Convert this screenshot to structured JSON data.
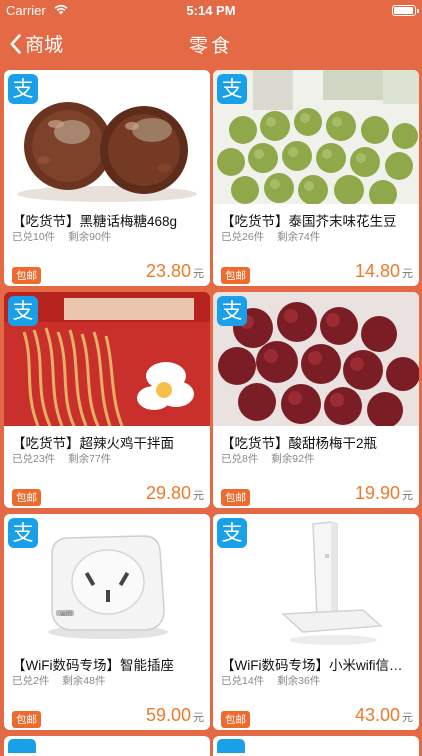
{
  "status_bar": {
    "carrier": "Carrier",
    "time": "5:14 PM"
  },
  "nav": {
    "back_label": "商城",
    "title": "零食"
  },
  "badge_char": "支",
  "products": [
    {
      "title": "【吃货节】黑糖话梅糖468g",
      "exchanged": "已兑10件",
      "remaining": "剩余90件",
      "tag": "包邮",
      "price": "23.80",
      "unit": "元"
    },
    {
      "title": "【吃货节】泰国芥末味花生豆",
      "exchanged": "已兑26件",
      "remaining": "剩余74件",
      "tag": "包邮",
      "price": "14.80",
      "unit": "元"
    },
    {
      "title": "【吃货节】超辣火鸡干拌面",
      "exchanged": "已兑23件",
      "remaining": "剩余77件",
      "tag": "包邮",
      "price": "29.80",
      "unit": "元"
    },
    {
      "title": "【吃货节】酸甜杨梅干2瓶",
      "exchanged": "已兑8件",
      "remaining": "剩余92件",
      "tag": "包邮",
      "price": "19.90",
      "unit": "元"
    },
    {
      "title": "【WiFi数码专场】智能插座",
      "exchanged": "已兑2件",
      "remaining": "剩余48件",
      "tag": "包邮",
      "price": "59.00",
      "unit": "元"
    },
    {
      "title": "【WiFi数码专场】小米wifi信号…",
      "exchanged": "已兑14件",
      "remaining": "剩余36件",
      "tag": "包邮",
      "price": "43.00",
      "unit": "元"
    }
  ],
  "images": {
    "p1": "candy-balls",
    "p2": "wasabi-peas",
    "p3": "fire-noodles",
    "p4": "bayberries",
    "p5": "wifi-smart-plug",
    "p6": "wifi-repeater",
    "p5_brand": "wifi"
  }
}
